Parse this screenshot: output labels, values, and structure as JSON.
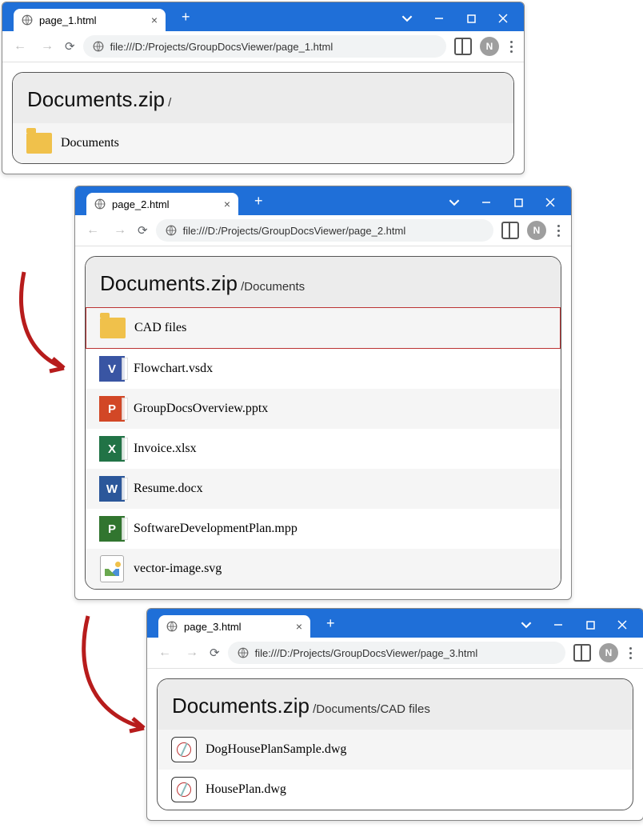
{
  "avatar_initial": "N",
  "windows": [
    {
      "tab_title": "page_1.html",
      "url": "file:///D:/Projects/GroupDocsViewer/page_1.html",
      "archive_name": "Documents.zip",
      "path": "/",
      "items": [
        {
          "type": "folder",
          "name": "Documents"
        }
      ]
    },
    {
      "tab_title": "page_2.html",
      "url": "file:///D:/Projects/GroupDocsViewer/page_2.html",
      "archive_name": "Documents.zip",
      "path": "/Documents",
      "items": [
        {
          "type": "folder",
          "name": "CAD files",
          "highlighted": true
        },
        {
          "type": "visio",
          "letter": "V",
          "name": "Flowchart.vsdx"
        },
        {
          "type": "ppt",
          "letter": "P",
          "name": "GroupDocsOverview.pptx"
        },
        {
          "type": "xls",
          "letter": "X",
          "name": "Invoice.xlsx"
        },
        {
          "type": "doc",
          "letter": "W",
          "name": "Resume.docx"
        },
        {
          "type": "mpp",
          "letter": "P",
          "name": "SoftwareDevelopmentPlan.mpp"
        },
        {
          "type": "svg",
          "name": "vector-image.svg"
        }
      ]
    },
    {
      "tab_title": "page_3.html",
      "url": "file:///D:/Projects/GroupDocsViewer/page_3.html",
      "archive_name": "Documents.zip",
      "path": "/Documents/CAD files",
      "items": [
        {
          "type": "cad",
          "name": "DogHousePlanSample.dwg"
        },
        {
          "type": "cad",
          "name": "HousePlan.dwg"
        }
      ]
    }
  ]
}
